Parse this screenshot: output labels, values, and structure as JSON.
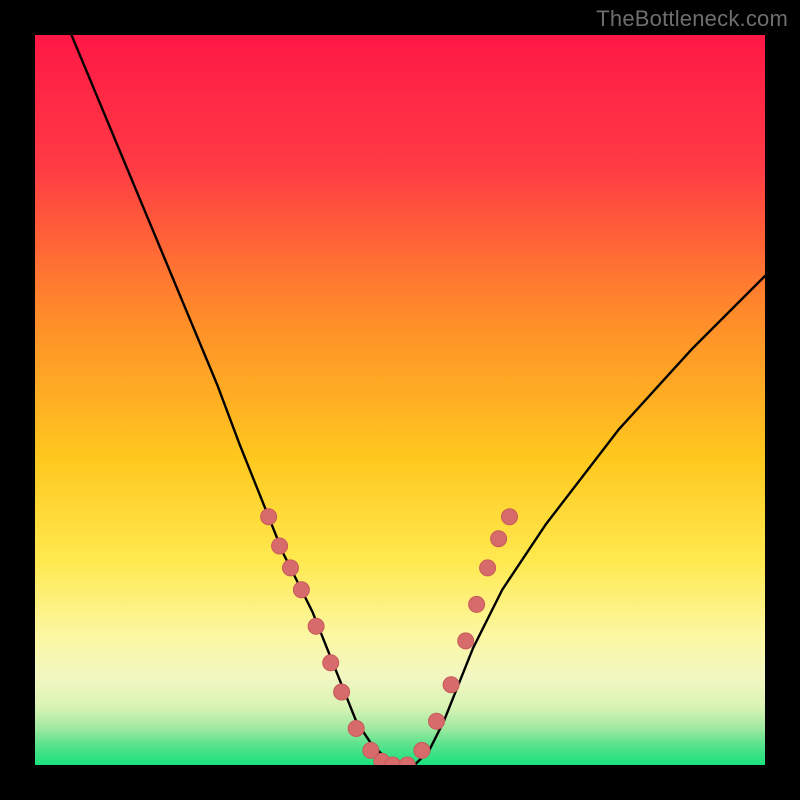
{
  "watermark": "TheBottleneck.com",
  "colors": {
    "bg": "#000000",
    "grad_top": "#ff1744",
    "grad_mid1": "#ff5a3c",
    "grad_mid2": "#ffb000",
    "grad_mid3": "#ffe040",
    "grad_mid4": "#f7f79e",
    "grad_bottom": "#19e27d",
    "curve": "#000000",
    "dot": "#d76a6a",
    "dot_stroke": "#c95a5a"
  },
  "chart_data": {
    "type": "line",
    "title": "",
    "xlabel": "",
    "ylabel": "",
    "xlim": [
      0,
      100
    ],
    "ylim": [
      0,
      100
    ],
    "note": "V-shaped bottleneck curve; y decreases steeply to a flat minimum around x≈45–52 then rises; background hue encodes y (red=high, green=low). Pink dots mark sampled points on the curve in the lower region.",
    "series": [
      {
        "name": "bottleneck-curve",
        "x": [
          5,
          10,
          15,
          20,
          25,
          28,
          30,
          32,
          34,
          36,
          38,
          40,
          42,
          44,
          46,
          48,
          50,
          52,
          54,
          56,
          58,
          60,
          62,
          64,
          70,
          80,
          90,
          100
        ],
        "y": [
          100,
          88,
          76,
          64,
          52,
          44,
          39,
          34,
          29,
          25,
          21,
          16,
          11,
          6,
          3,
          1,
          0,
          0,
          2,
          6,
          11,
          16,
          20,
          24,
          33,
          46,
          57,
          67
        ]
      }
    ],
    "dots": [
      {
        "x": 32.0,
        "y": 34
      },
      {
        "x": 33.5,
        "y": 30
      },
      {
        "x": 35.0,
        "y": 27
      },
      {
        "x": 36.5,
        "y": 24
      },
      {
        "x": 38.5,
        "y": 19
      },
      {
        "x": 40.5,
        "y": 14
      },
      {
        "x": 42.0,
        "y": 10
      },
      {
        "x": 44.0,
        "y": 5
      },
      {
        "x": 46.0,
        "y": 2
      },
      {
        "x": 47.5,
        "y": 0.5
      },
      {
        "x": 49.0,
        "y": 0
      },
      {
        "x": 51.0,
        "y": 0
      },
      {
        "x": 53.0,
        "y": 2
      },
      {
        "x": 55.0,
        "y": 6
      },
      {
        "x": 57.0,
        "y": 11
      },
      {
        "x": 59.0,
        "y": 17
      },
      {
        "x": 60.5,
        "y": 22
      },
      {
        "x": 62.0,
        "y": 27
      },
      {
        "x": 63.5,
        "y": 31
      },
      {
        "x": 65.0,
        "y": 34
      }
    ],
    "gradient_bands": [
      {
        "y": 100,
        "color": "#ff1744"
      },
      {
        "y": 55,
        "color": "#ff8a2a"
      },
      {
        "y": 35,
        "color": "#ffd400"
      },
      {
        "y": 18,
        "color": "#fff176"
      },
      {
        "y": 6,
        "color": "#f4f8c0"
      },
      {
        "y": 0,
        "color": "#19e27d"
      }
    ]
  }
}
